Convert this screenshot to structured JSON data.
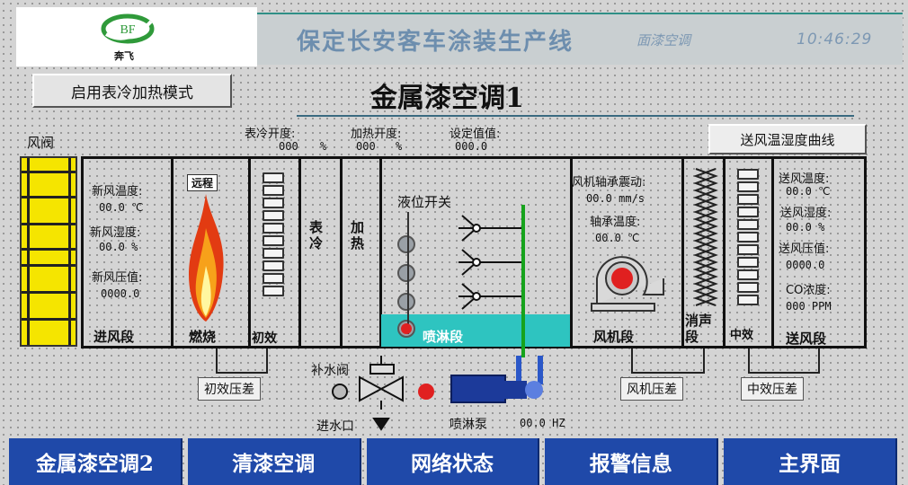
{
  "header": {
    "brand_mark": "BF",
    "brand_name": "奔飞",
    "line_title": "保定长安客车涂装生产线",
    "line_sub": "面漆空调",
    "time": "10:46:29"
  },
  "mode_button": "启用表冷加热模式",
  "page_title": "金属漆空调1",
  "readouts": {
    "cooling_label": "表冷开度:",
    "cooling_value": "000",
    "cooling_unit": "%",
    "heating_label": "加热开度:",
    "heating_value": "000",
    "heating_unit": "%",
    "set_label": "设定值值:",
    "set_value": "000.0"
  },
  "curve_button": "送风温湿度曲线",
  "damper_label": "风阀",
  "intake": {
    "temp_label": "新风温度:",
    "temp_value": "00.0 ℃",
    "hum_label": "新风湿度:",
    "hum_value": "00.0 %",
    "press_label": "新风压值:",
    "press_value": "0000.0",
    "name": "进风段"
  },
  "burner": {
    "tag": "远程",
    "name": "燃烧"
  },
  "primary": {
    "name": "初效"
  },
  "cooler": {
    "name": "表冷"
  },
  "heater": {
    "name": "加热"
  },
  "spray": {
    "level_label": "液位开关",
    "name": "喷淋段"
  },
  "fan": {
    "vib_label": "风机轴承震动:",
    "vib_value": "00.0 mm/s",
    "bearing_label": "轴承温度:",
    "bearing_value": "00.0 ℃",
    "name": "风机段"
  },
  "silencer": {
    "name": "消声段"
  },
  "medium": {
    "name": "中效"
  },
  "supply": {
    "temp_label": "送风温度:",
    "temp_value": "00.0 ℃",
    "hum_label": "送风湿度:",
    "hum_value": "00.0 %",
    "press_label": "送风压值:",
    "press_value": "0000.0",
    "co_label": "CO浓度:",
    "co_value": "000 PPM",
    "name": "送风段"
  },
  "bottom": {
    "primary_dp": "初效压差",
    "makeup_valve": "补水阀",
    "water_inlet": "进水口",
    "pump_label": "喷淋泵",
    "pump_value": "00.0 HZ",
    "fan_dp": "风机压差",
    "medium_dp": "中效压差"
  },
  "nav": [
    {
      "label": "金属漆空调2"
    },
    {
      "label": "清漆空调"
    },
    {
      "label": "网络状态"
    },
    {
      "label": "报警信息"
    },
    {
      "label": "主界面"
    }
  ],
  "colors": {
    "damper": "#f5e500",
    "spray_water": "#2ec4c0",
    "pipe": "#16a31c",
    "nav": "#1f49a9",
    "alarm": "#e02020"
  }
}
